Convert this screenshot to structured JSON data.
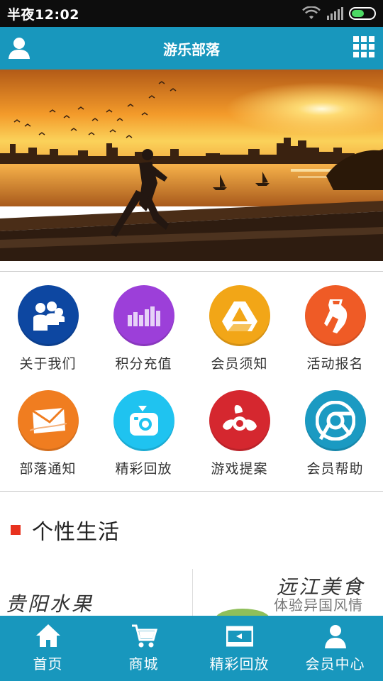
{
  "status_bar": {
    "time": "半夜12:02"
  },
  "header": {
    "title": "游乐部落",
    "left_icon": "user-icon",
    "right_icon": "grid-menu-icon"
  },
  "banner": {
    "description_icon": "banner-image"
  },
  "grid": [
    {
      "label": "关于我们",
      "icon": "people-icon",
      "color": "#0d47a1"
    },
    {
      "label": "积分充值",
      "icon": "bars-icon",
      "color": "#9c3fd9"
    },
    {
      "label": "会员须知",
      "icon": "drive-icon",
      "color": "#f2a617"
    },
    {
      "label": "活动报名",
      "icon": "flask-icon",
      "color": "#ef5b26"
    },
    {
      "label": "部落通知",
      "icon": "mail-icon",
      "color": "#f07d20"
    },
    {
      "label": "精彩回放",
      "icon": "camera-icon",
      "color": "#1fc3f0"
    },
    {
      "label": "游戏提案",
      "icon": "air-icon",
      "color": "#d5272f"
    },
    {
      "label": "会员帮助",
      "icon": "chrome-icon",
      "color": "#1b9ac2"
    }
  ],
  "section": {
    "title": "个性生活"
  },
  "thumbs": {
    "left_caption": "贵阳水果",
    "right_caption": "远江美食",
    "right_sub": "体验异国风情"
  },
  "tabbar": [
    {
      "label": "首页",
      "icon": "home-icon"
    },
    {
      "label": "商城",
      "icon": "cart-icon"
    },
    {
      "label": "精彩回放",
      "icon": "film-icon"
    },
    {
      "label": "会员中心",
      "icon": "member-icon"
    }
  ],
  "colors": {
    "primary": "#1897bd",
    "accent": "#e8321e"
  }
}
